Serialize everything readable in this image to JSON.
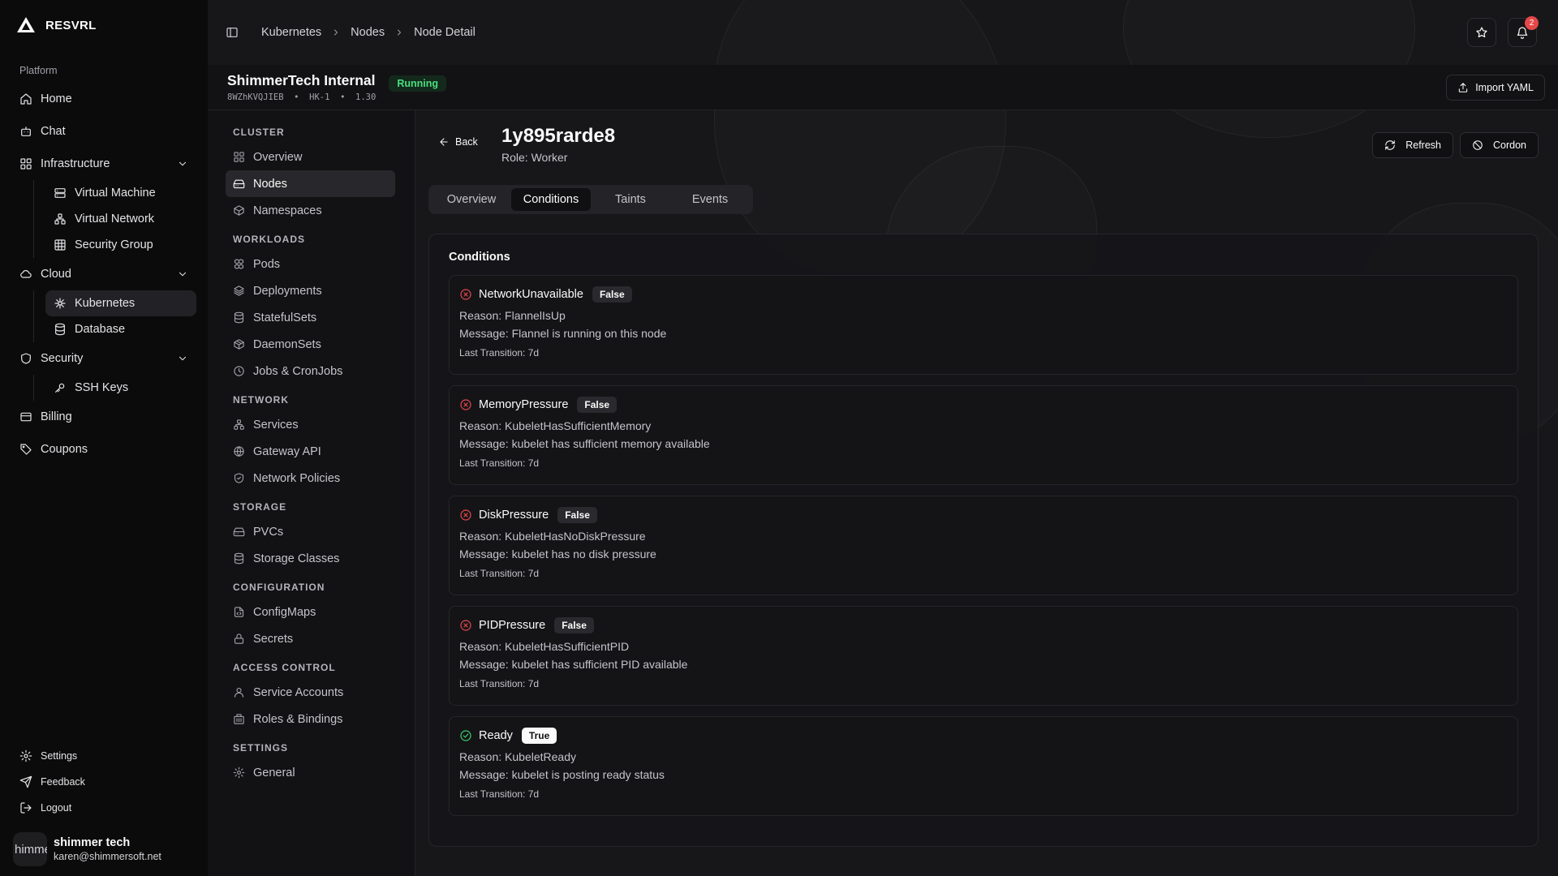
{
  "brand": {
    "name": "RESVRL"
  },
  "sidebar": {
    "section_label": "Platform",
    "items": [
      {
        "label": "Home"
      },
      {
        "label": "Chat"
      },
      {
        "label": "Infrastructure",
        "children": [
          {
            "label": "Virtual Machine"
          },
          {
            "label": "Virtual Network"
          },
          {
            "label": "Security Group"
          }
        ]
      },
      {
        "label": "Cloud",
        "children": [
          {
            "label": "Kubernetes"
          },
          {
            "label": "Database"
          }
        ]
      },
      {
        "label": "Security",
        "children": [
          {
            "label": "SSH Keys"
          }
        ]
      },
      {
        "label": "Billing"
      },
      {
        "label": "Coupons"
      }
    ],
    "bottom": [
      {
        "label": "Settings"
      },
      {
        "label": "Feedback"
      },
      {
        "label": "Logout"
      }
    ],
    "user": {
      "avatar_text": "himme",
      "name": "shimmer tech",
      "email": "karen@shimmersoft.net"
    }
  },
  "topbar": {
    "breadcrumbs": [
      "Kubernetes",
      "Nodes",
      "Node Detail"
    ],
    "notification_count": "2"
  },
  "cluster": {
    "name": "ShimmerTech Internal",
    "meta": "8WZhKVQJIEB  •  HK-1  •  1.30",
    "status": "Running",
    "import_label": "Import YAML"
  },
  "subnav": {
    "groups": [
      {
        "label": "CLUSTER",
        "items": [
          {
            "label": "Overview"
          },
          {
            "label": "Nodes"
          },
          {
            "label": "Namespaces"
          }
        ]
      },
      {
        "label": "WORKLOADS",
        "items": [
          {
            "label": "Pods"
          },
          {
            "label": "Deployments"
          },
          {
            "label": "StatefulSets"
          },
          {
            "label": "DaemonSets"
          },
          {
            "label": "Jobs & CronJobs"
          }
        ]
      },
      {
        "label": "NETWORK",
        "items": [
          {
            "label": "Services"
          },
          {
            "label": "Gateway API"
          },
          {
            "label": "Network Policies"
          }
        ]
      },
      {
        "label": "STORAGE",
        "items": [
          {
            "label": "PVCs"
          },
          {
            "label": "Storage Classes"
          }
        ]
      },
      {
        "label": "CONFIGURATION",
        "items": [
          {
            "label": "ConfigMaps"
          },
          {
            "label": "Secrets"
          }
        ]
      },
      {
        "label": "ACCESS CONTROL",
        "items": [
          {
            "label": "Service Accounts"
          },
          {
            "label": "Roles & Bindings"
          }
        ]
      },
      {
        "label": "SETTINGS",
        "items": [
          {
            "label": "General"
          }
        ]
      }
    ]
  },
  "node": {
    "back_label": "Back",
    "name": "1y895rarde8",
    "role": "Role: Worker",
    "refresh_label": "Refresh",
    "cordon_label": "Cordon",
    "tabs": [
      {
        "label": "Overview"
      },
      {
        "label": "Conditions"
      },
      {
        "label": "Taints"
      },
      {
        "label": "Events"
      }
    ]
  },
  "conditions": {
    "title": "Conditions",
    "items": [
      {
        "type": "NetworkUnavailable",
        "status": "False",
        "reason": "Reason: FlannelIsUp",
        "message": "Message: Flannel is running on this node",
        "transition": "Last Transition: 7d"
      },
      {
        "type": "MemoryPressure",
        "status": "False",
        "reason": "Reason: KubeletHasSufficientMemory",
        "message": "Message: kubelet has sufficient memory available",
        "transition": "Last Transition: 7d"
      },
      {
        "type": "DiskPressure",
        "status": "False",
        "reason": "Reason: KubeletHasNoDiskPressure",
        "message": "Message: kubelet has no disk pressure",
        "transition": "Last Transition: 7d"
      },
      {
        "type": "PIDPressure",
        "status": "False",
        "reason": "Reason: KubeletHasSufficientPID",
        "message": "Message: kubelet has sufficient PID available",
        "transition": "Last Transition: 7d"
      },
      {
        "type": "Ready",
        "status": "True",
        "reason": "Reason: KubeletReady",
        "message": "Message: kubelet is posting ready status",
        "transition": "Last Transition: 7d"
      }
    ]
  },
  "colors": {
    "bad": "#e5484d",
    "good": "#3ecf6e",
    "running_bg": "#13291c",
    "running_fg": "#4ade80"
  }
}
